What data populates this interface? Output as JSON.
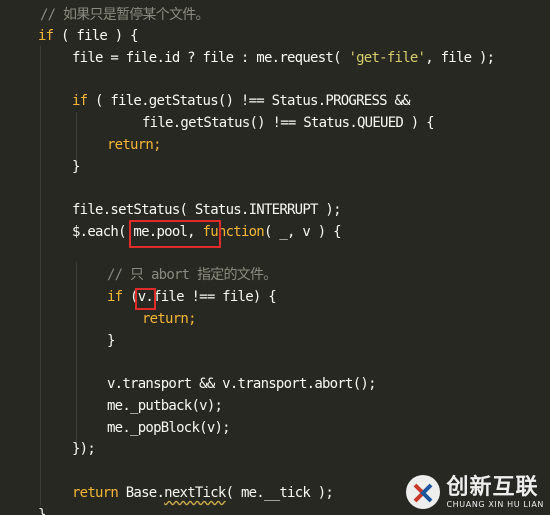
{
  "code": {
    "lines": [
      [
        {
          "t": "// 如果只是暂停某个文件。",
          "c": "cm"
        }
      ],
      [
        {
          "t": "if",
          "c": "kw"
        },
        {
          "t": " ( file ) {",
          "c": "pun"
        }
      ],
      [
        {
          "t": "file = file.id ? file : me.request( ",
          "c": "id"
        },
        {
          "t": "'get-file'",
          "c": "str"
        },
        {
          "t": ", file );",
          "c": "pun"
        }
      ],
      [],
      [
        {
          "t": "if",
          "c": "kw"
        },
        {
          "t": " ( file.getStatus() !== Status.PROGRESS &&",
          "c": "id"
        }
      ],
      [
        {
          "t": "file.getStatus() !== Status.QUEUED ) {",
          "c": "id"
        }
      ],
      [
        {
          "t": "return;",
          "c": "kw"
        }
      ],
      [
        {
          "t": "}",
          "c": "pun"
        }
      ],
      [],
      [
        {
          "t": "file.setStatus( Status.INTERRUPT );",
          "c": "id"
        }
      ],
      [
        {
          "t": "$.each( me.pool, ",
          "c": "id"
        },
        {
          "t": "function",
          "c": "kw"
        },
        {
          "t": "( _, v ) {",
          "c": "id"
        }
      ],
      [],
      [
        {
          "t": "// 只 abort 指定的文件。",
          "c": "cm"
        }
      ],
      [
        {
          "t": "if",
          "c": "kw"
        },
        {
          "t": " (v.file !== file) {",
          "c": "id"
        }
      ],
      [
        {
          "t": "return;",
          "c": "kw"
        }
      ],
      [
        {
          "t": "}",
          "c": "pun"
        }
      ],
      [],
      [
        {
          "t": "v.transport && v.transport.abort();",
          "c": "id"
        }
      ],
      [
        {
          "t": "me._putback(v);",
          "c": "id"
        }
      ],
      [
        {
          "t": "me._popBlock(v);",
          "c": "id"
        }
      ],
      [
        {
          "t": "});",
          "c": "pun"
        }
      ],
      [],
      [
        {
          "t": "return",
          "c": "kw"
        },
        {
          "t": " Base.",
          "c": "id"
        },
        {
          "t": "nextTick",
          "c": "squig"
        },
        {
          "t": "( me.__tick );",
          "c": "id"
        }
      ],
      [
        {
          "t": "}",
          "c": "pun"
        }
      ]
    ]
  },
  "watermark": {
    "cn": "创新互联",
    "en": "CHUANG XIN HU LIAN"
  },
  "colors": {
    "background": "#272822",
    "keyword": "#f4b638",
    "comment": "#8a8a80",
    "string": "#d8ce6d",
    "highlight_box": "#e02b2b"
  }
}
